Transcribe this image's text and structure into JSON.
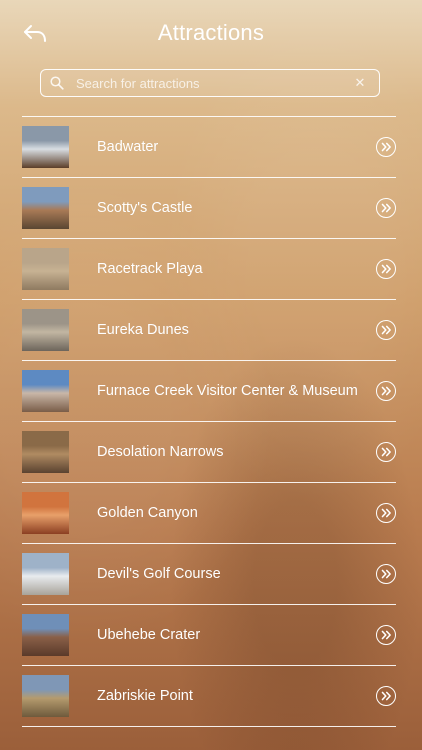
{
  "header": {
    "title": "Attractions",
    "back_icon": "back-arrow-icon"
  },
  "search": {
    "placeholder": "Search for attractions",
    "value": "",
    "clear_label": "✕"
  },
  "attractions": [
    {
      "name": "Badwater",
      "thumb_colors": [
        "#8a98a8",
        "#d8dde2",
        "#5b3e28"
      ]
    },
    {
      "name": "Scotty's Castle",
      "thumb_colors": [
        "#7f9bbd",
        "#a97a56",
        "#5a4632"
      ]
    },
    {
      "name": "Racetrack Playa",
      "thumb_colors": [
        "#b9a58a",
        "#c7b293",
        "#8e7a60"
      ]
    },
    {
      "name": "Eureka Dunes",
      "thumb_colors": [
        "#9c9488",
        "#c2b6a2",
        "#6d655b"
      ]
    },
    {
      "name": "Furnace Creek Visitor Center & Museum",
      "thumb_colors": [
        "#5d8ac2",
        "#c9b7a8",
        "#7a5d48"
      ]
    },
    {
      "name": "Desolation Narrows",
      "thumb_colors": [
        "#8a6a48",
        "#b08b62",
        "#5a4230"
      ]
    },
    {
      "name": "Golden Canyon",
      "thumb_colors": [
        "#d1743e",
        "#e8a06a",
        "#8b3f22"
      ]
    },
    {
      "name": "Devil's Golf Course",
      "thumb_colors": [
        "#9eb2c8",
        "#e8ebee",
        "#a8a39a"
      ]
    },
    {
      "name": "Ubehebe Crater",
      "thumb_colors": [
        "#6f8fb8",
        "#8a6048",
        "#5a3a2a"
      ]
    },
    {
      "name": "Zabriskie Point",
      "thumb_colors": [
        "#7f97b6",
        "#b59b6e",
        "#6e5a3c"
      ]
    }
  ],
  "row_action_icon": "chevron-double-right-circle-icon",
  "colors": {
    "text": "#ffffff",
    "background_top": "#e9d7b9",
    "background_bottom": "#9b5f3a"
  }
}
